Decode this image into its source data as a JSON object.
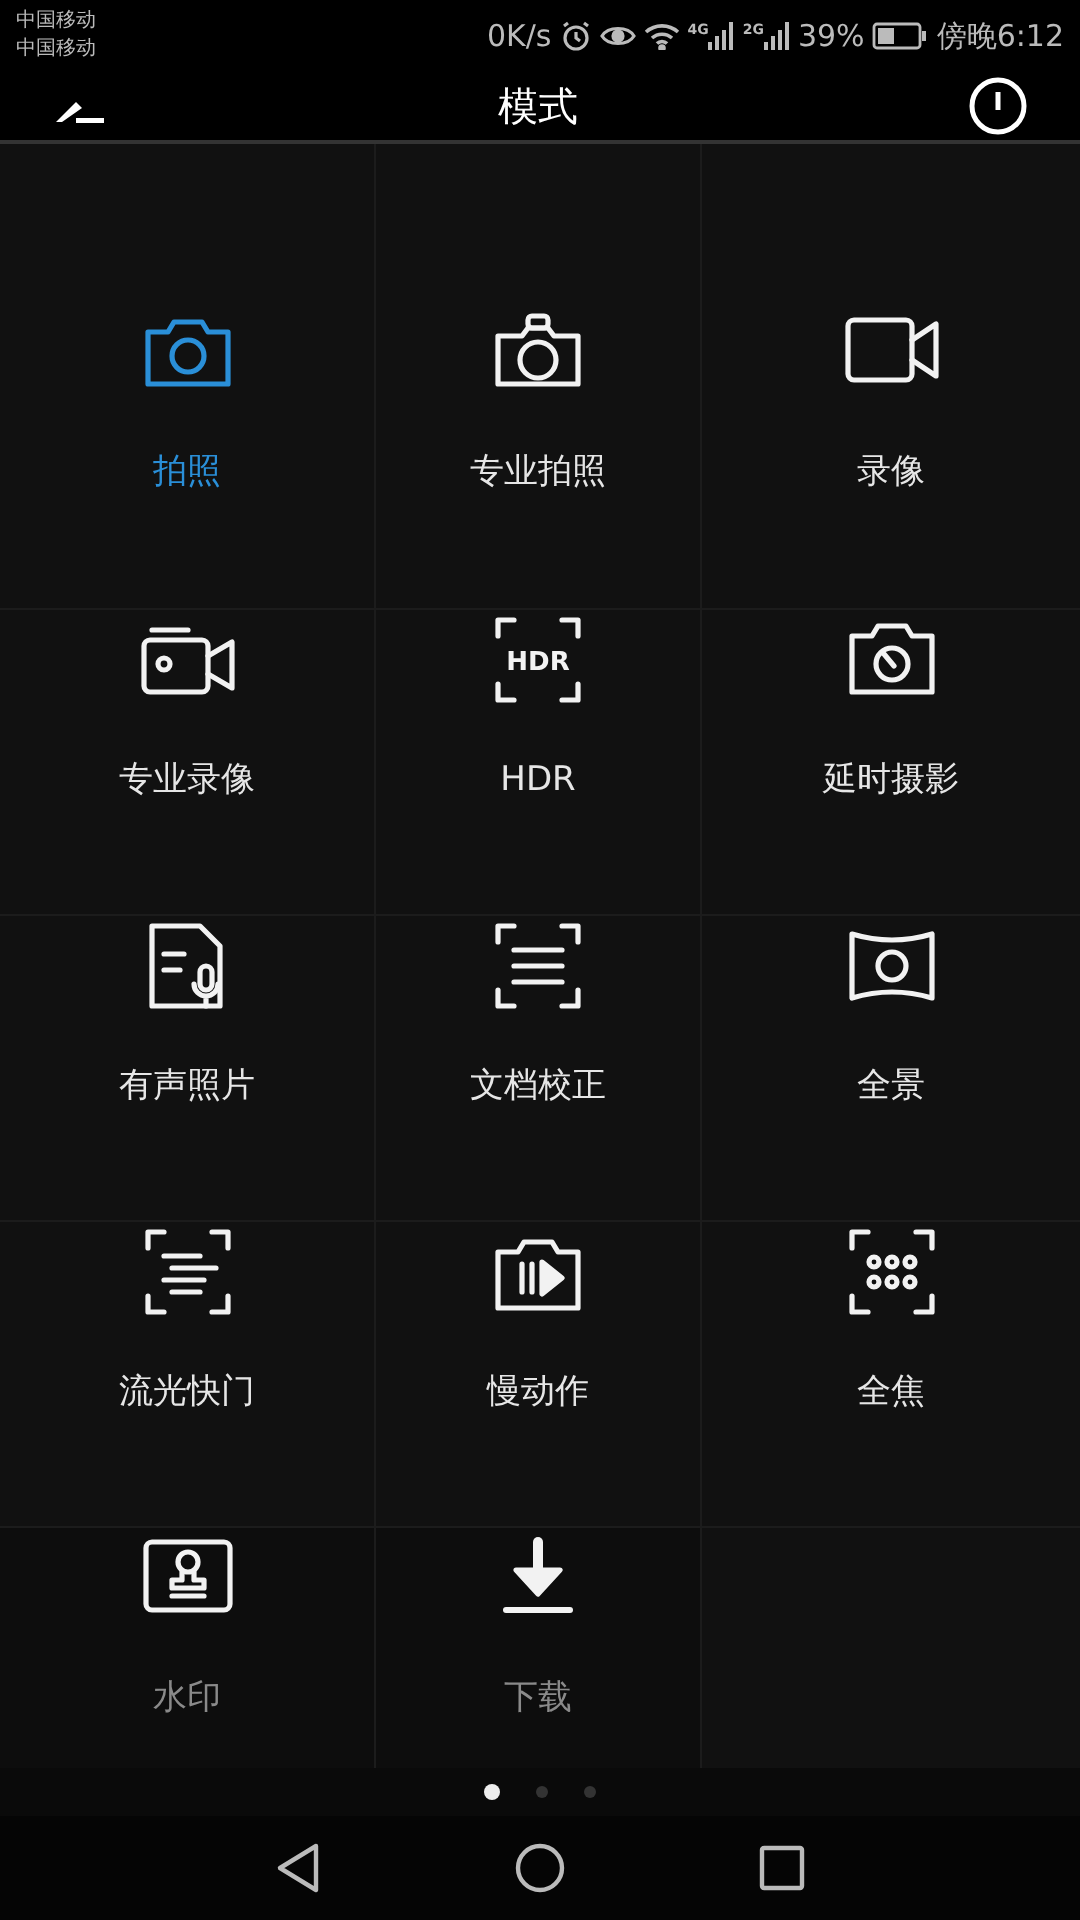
{
  "status_bar": {
    "carriers": [
      "中国移动",
      "中国移动"
    ],
    "speed": "0K/s",
    "signals": [
      {
        "network": "4G"
      },
      {
        "network": "2G"
      }
    ],
    "battery": "39%",
    "time": "傍晚6:12"
  },
  "header": {
    "title": "模式"
  },
  "modes": [
    {
      "label": "拍照",
      "selected": true,
      "kind": "mode"
    },
    {
      "label": "专业拍照",
      "selected": false,
      "kind": "mode"
    },
    {
      "label": "录像",
      "selected": false,
      "kind": "mode"
    },
    {
      "label": "专业录像",
      "selected": false,
      "kind": "mode"
    },
    {
      "label": "HDR",
      "selected": false,
      "kind": "mode"
    },
    {
      "label": "延时摄影",
      "selected": false,
      "kind": "mode"
    },
    {
      "label": "有声照片",
      "selected": false,
      "kind": "mode"
    },
    {
      "label": "文档校正",
      "selected": false,
      "kind": "mode"
    },
    {
      "label": "全景",
      "selected": false,
      "kind": "mode"
    },
    {
      "label": "流光快门",
      "selected": false,
      "kind": "mode"
    },
    {
      "label": "慢动作",
      "selected": false,
      "kind": "mode"
    },
    {
      "label": "全焦",
      "selected": false,
      "kind": "mode"
    },
    {
      "label": "水印",
      "selected": false,
      "kind": "action"
    },
    {
      "label": "下载",
      "selected": false,
      "kind": "action"
    }
  ],
  "hdr_icon": {
    "text": "HDR"
  },
  "pages": [
    {
      "selected": true
    },
    {
      "selected": false
    },
    {
      "selected": false
    }
  ]
}
